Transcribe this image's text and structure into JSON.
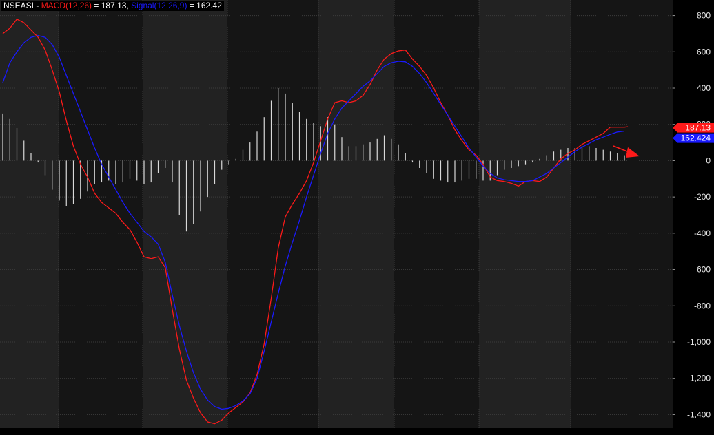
{
  "legend": {
    "symbol": "NSEASI",
    "sep": " - ",
    "macd_label": "MACD(12,26)",
    "macd_value": " = 187.13, ",
    "signal_label": "Signal(12,26,9)",
    "signal_value": " = 162.42"
  },
  "colors": {
    "background": "#000000",
    "band_dark": "#151515",
    "band_light": "#222222",
    "grid": "#3c3c3c",
    "macd": "#ff1a1a",
    "signal": "#1a1aff",
    "histogram": "#d9d9d9",
    "arrow": "#ff1a1a"
  },
  "chart_data": {
    "type": "line",
    "title": "",
    "xlabel": "",
    "ylabel": "",
    "ylim": [
      -1480,
      880
    ],
    "y_ticks": [
      800,
      600,
      400,
      200,
      0,
      -200,
      -400,
      -600,
      -800,
      -1000,
      -1200,
      -1400
    ],
    "y_tick_labels": [
      "800",
      "600",
      "400",
      "200",
      "0",
      "-200",
      "-400",
      "-600",
      "-800",
      "-1,000",
      "-1,200",
      "-1,400"
    ],
    "x_count": 180,
    "series": [
      {
        "name": "MACD(12,26)",
        "color": "#ff1a1a",
        "points": [
          [
            0,
            700
          ],
          [
            2,
            730
          ],
          [
            4,
            780
          ],
          [
            6,
            760
          ],
          [
            8,
            720
          ],
          [
            10,
            680
          ],
          [
            12,
            610
          ],
          [
            14,
            500
          ],
          [
            16,
            380
          ],
          [
            18,
            220
          ],
          [
            20,
            80
          ],
          [
            22,
            -20
          ],
          [
            24,
            -90
          ],
          [
            26,
            -180
          ],
          [
            28,
            -230
          ],
          [
            30,
            -260
          ],
          [
            32,
            -290
          ],
          [
            34,
            -340
          ],
          [
            36,
            -380
          ],
          [
            38,
            -450
          ],
          [
            40,
            -530
          ],
          [
            42,
            -540
          ],
          [
            44,
            -530
          ],
          [
            46,
            -590
          ],
          [
            48,
            -820
          ],
          [
            50,
            -1040
          ],
          [
            52,
            -1210
          ],
          [
            54,
            -1310
          ],
          [
            56,
            -1390
          ],
          [
            58,
            -1440
          ],
          [
            60,
            -1450
          ],
          [
            62,
            -1430
          ],
          [
            64,
            -1390
          ],
          [
            66,
            -1360
          ],
          [
            68,
            -1330
          ],
          [
            70,
            -1280
          ],
          [
            72,
            -1180
          ],
          [
            74,
            -1010
          ],
          [
            76,
            -760
          ],
          [
            78,
            -480
          ],
          [
            80,
            -310
          ],
          [
            82,
            -240
          ],
          [
            84,
            -180
          ],
          [
            86,
            -110
          ],
          [
            88,
            -10
          ],
          [
            90,
            110
          ],
          [
            92,
            230
          ],
          [
            94,
            320
          ],
          [
            96,
            330
          ],
          [
            98,
            320
          ],
          [
            100,
            330
          ],
          [
            102,
            360
          ],
          [
            104,
            420
          ],
          [
            106,
            500
          ],
          [
            108,
            560
          ],
          [
            110,
            590
          ],
          [
            112,
            605
          ],
          [
            114,
            610
          ],
          [
            116,
            560
          ],
          [
            118,
            520
          ],
          [
            120,
            470
          ],
          [
            122,
            400
          ],
          [
            124,
            320
          ],
          [
            126,
            250
          ],
          [
            128,
            170
          ],
          [
            130,
            110
          ],
          [
            132,
            60
          ],
          [
            134,
            30
          ],
          [
            136,
            -20
          ],
          [
            138,
            -90
          ],
          [
            140,
            -110
          ],
          [
            142,
            -115
          ],
          [
            144,
            -125
          ],
          [
            146,
            -140
          ],
          [
            148,
            -115
          ],
          [
            150,
            -110
          ],
          [
            152,
            -115
          ],
          [
            154,
            -90
          ],
          [
            156,
            -40
          ],
          [
            158,
            10
          ],
          [
            160,
            40
          ],
          [
            162,
            60
          ],
          [
            164,
            90
          ],
          [
            166,
            110
          ],
          [
            168,
            130
          ],
          [
            170,
            150
          ],
          [
            172,
            185
          ],
          [
            174,
            185
          ],
          [
            176,
            185
          ],
          [
            177,
            187.13
          ]
        ]
      },
      {
        "name": "Signal(12,26,9)",
        "color": "#1a1aff",
        "points": [
          [
            0,
            430
          ],
          [
            2,
            540
          ],
          [
            4,
            600
          ],
          [
            6,
            650
          ],
          [
            8,
            680
          ],
          [
            10,
            690
          ],
          [
            12,
            680
          ],
          [
            14,
            640
          ],
          [
            16,
            570
          ],
          [
            18,
            470
          ],
          [
            20,
            370
          ],
          [
            22,
            270
          ],
          [
            24,
            170
          ],
          [
            26,
            70
          ],
          [
            28,
            -20
          ],
          [
            30,
            -90
          ],
          [
            32,
            -160
          ],
          [
            34,
            -230
          ],
          [
            36,
            -290
          ],
          [
            38,
            -340
          ],
          [
            40,
            -390
          ],
          [
            42,
            -420
          ],
          [
            44,
            -460
          ],
          [
            46,
            -560
          ],
          [
            48,
            -740
          ],
          [
            50,
            -910
          ],
          [
            52,
            -1050
          ],
          [
            54,
            -1170
          ],
          [
            56,
            -1260
          ],
          [
            58,
            -1320
          ],
          [
            60,
            -1355
          ],
          [
            62,
            -1370
          ],
          [
            64,
            -1365
          ],
          [
            66,
            -1350
          ],
          [
            68,
            -1325
          ],
          [
            70,
            -1285
          ],
          [
            72,
            -1200
          ],
          [
            74,
            -1050
          ],
          [
            76,
            -890
          ],
          [
            78,
            -730
          ],
          [
            80,
            -580
          ],
          [
            82,
            -450
          ],
          [
            84,
            -330
          ],
          [
            86,
            -200
          ],
          [
            88,
            -80
          ],
          [
            90,
            40
          ],
          [
            92,
            150
          ],
          [
            94,
            230
          ],
          [
            96,
            290
          ],
          [
            98,
            330
          ],
          [
            100,
            370
          ],
          [
            102,
            410
          ],
          [
            104,
            440
          ],
          [
            106,
            480
          ],
          [
            108,
            520
          ],
          [
            110,
            540
          ],
          [
            112,
            548
          ],
          [
            114,
            545
          ],
          [
            116,
            520
          ],
          [
            118,
            480
          ],
          [
            120,
            430
          ],
          [
            122,
            370
          ],
          [
            124,
            310
          ],
          [
            126,
            250
          ],
          [
            128,
            190
          ],
          [
            130,
            130
          ],
          [
            132,
            70
          ],
          [
            134,
            20
          ],
          [
            136,
            -30
          ],
          [
            138,
            -70
          ],
          [
            140,
            -95
          ],
          [
            142,
            -105
          ],
          [
            144,
            -110
          ],
          [
            146,
            -115
          ],
          [
            148,
            -115
          ],
          [
            150,
            -110
          ],
          [
            152,
            -90
          ],
          [
            154,
            -70
          ],
          [
            156,
            -40
          ],
          [
            158,
            -10
          ],
          [
            160,
            20
          ],
          [
            162,
            50
          ],
          [
            164,
            75
          ],
          [
            166,
            95
          ],
          [
            168,
            115
          ],
          [
            170,
            130
          ],
          [
            172,
            145
          ],
          [
            174,
            158
          ],
          [
            176,
            162.424
          ]
        ]
      },
      {
        "name": "Histogram",
        "color": "#d9d9d9",
        "points": [
          [
            0,
            260
          ],
          [
            2,
            230
          ],
          [
            4,
            180
          ],
          [
            6,
            110
          ],
          [
            8,
            40
          ],
          [
            10,
            -10
          ],
          [
            12,
            -80
          ],
          [
            14,
            -160
          ],
          [
            16,
            -220
          ],
          [
            18,
            -250
          ],
          [
            20,
            -240
          ],
          [
            22,
            -210
          ],
          [
            24,
            -170
          ],
          [
            26,
            -130
          ],
          [
            28,
            -120
          ],
          [
            30,
            -110
          ],
          [
            32,
            -130
          ],
          [
            34,
            -120
          ],
          [
            36,
            -100
          ],
          [
            38,
            -110
          ],
          [
            40,
            -130
          ],
          [
            42,
            -120
          ],
          [
            44,
            -70
          ],
          [
            46,
            -40
          ],
          [
            48,
            -120
          ],
          [
            50,
            -300
          ],
          [
            52,
            -390
          ],
          [
            54,
            -350
          ],
          [
            56,
            -280
          ],
          [
            58,
            -200
          ],
          [
            60,
            -130
          ],
          [
            62,
            -50
          ],
          [
            64,
            -20
          ],
          [
            66,
            10
          ],
          [
            68,
            60
          ],
          [
            70,
            100
          ],
          [
            72,
            160
          ],
          [
            74,
            240
          ],
          [
            76,
            330
          ],
          [
            78,
            400
          ],
          [
            80,
            370
          ],
          [
            82,
            320
          ],
          [
            84,
            270
          ],
          [
            86,
            230
          ],
          [
            88,
            210
          ],
          [
            90,
            190
          ],
          [
            92,
            240
          ],
          [
            94,
            200
          ],
          [
            96,
            130
          ],
          [
            98,
            80
          ],
          [
            100,
            80
          ],
          [
            102,
            90
          ],
          [
            104,
            100
          ],
          [
            106,
            120
          ],
          [
            108,
            140
          ],
          [
            110,
            120
          ],
          [
            112,
            90
          ],
          [
            114,
            40
          ],
          [
            116,
            -10
          ],
          [
            118,
            -40
          ],
          [
            120,
            -70
          ],
          [
            122,
            -100
          ],
          [
            124,
            -110
          ],
          [
            126,
            -120
          ],
          [
            128,
            -120
          ],
          [
            130,
            -110
          ],
          [
            132,
            -100
          ],
          [
            134,
            -100
          ],
          [
            136,
            -110
          ],
          [
            138,
            -110
          ],
          [
            140,
            -80
          ],
          [
            142,
            -50
          ],
          [
            144,
            -40
          ],
          [
            146,
            -30
          ],
          [
            148,
            -20
          ],
          [
            150,
            -10
          ],
          [
            152,
            10
          ],
          [
            154,
            30
          ],
          [
            156,
            50
          ],
          [
            158,
            60
          ],
          [
            160,
            70
          ],
          [
            162,
            70
          ],
          [
            164,
            80
          ],
          [
            166,
            80
          ],
          [
            168,
            70
          ],
          [
            170,
            60
          ],
          [
            172,
            50
          ],
          [
            174,
            40
          ],
          [
            176,
            30
          ]
        ]
      }
    ],
    "last_values": {
      "macd": "187.13",
      "signal": "162.424"
    },
    "grid": true
  }
}
